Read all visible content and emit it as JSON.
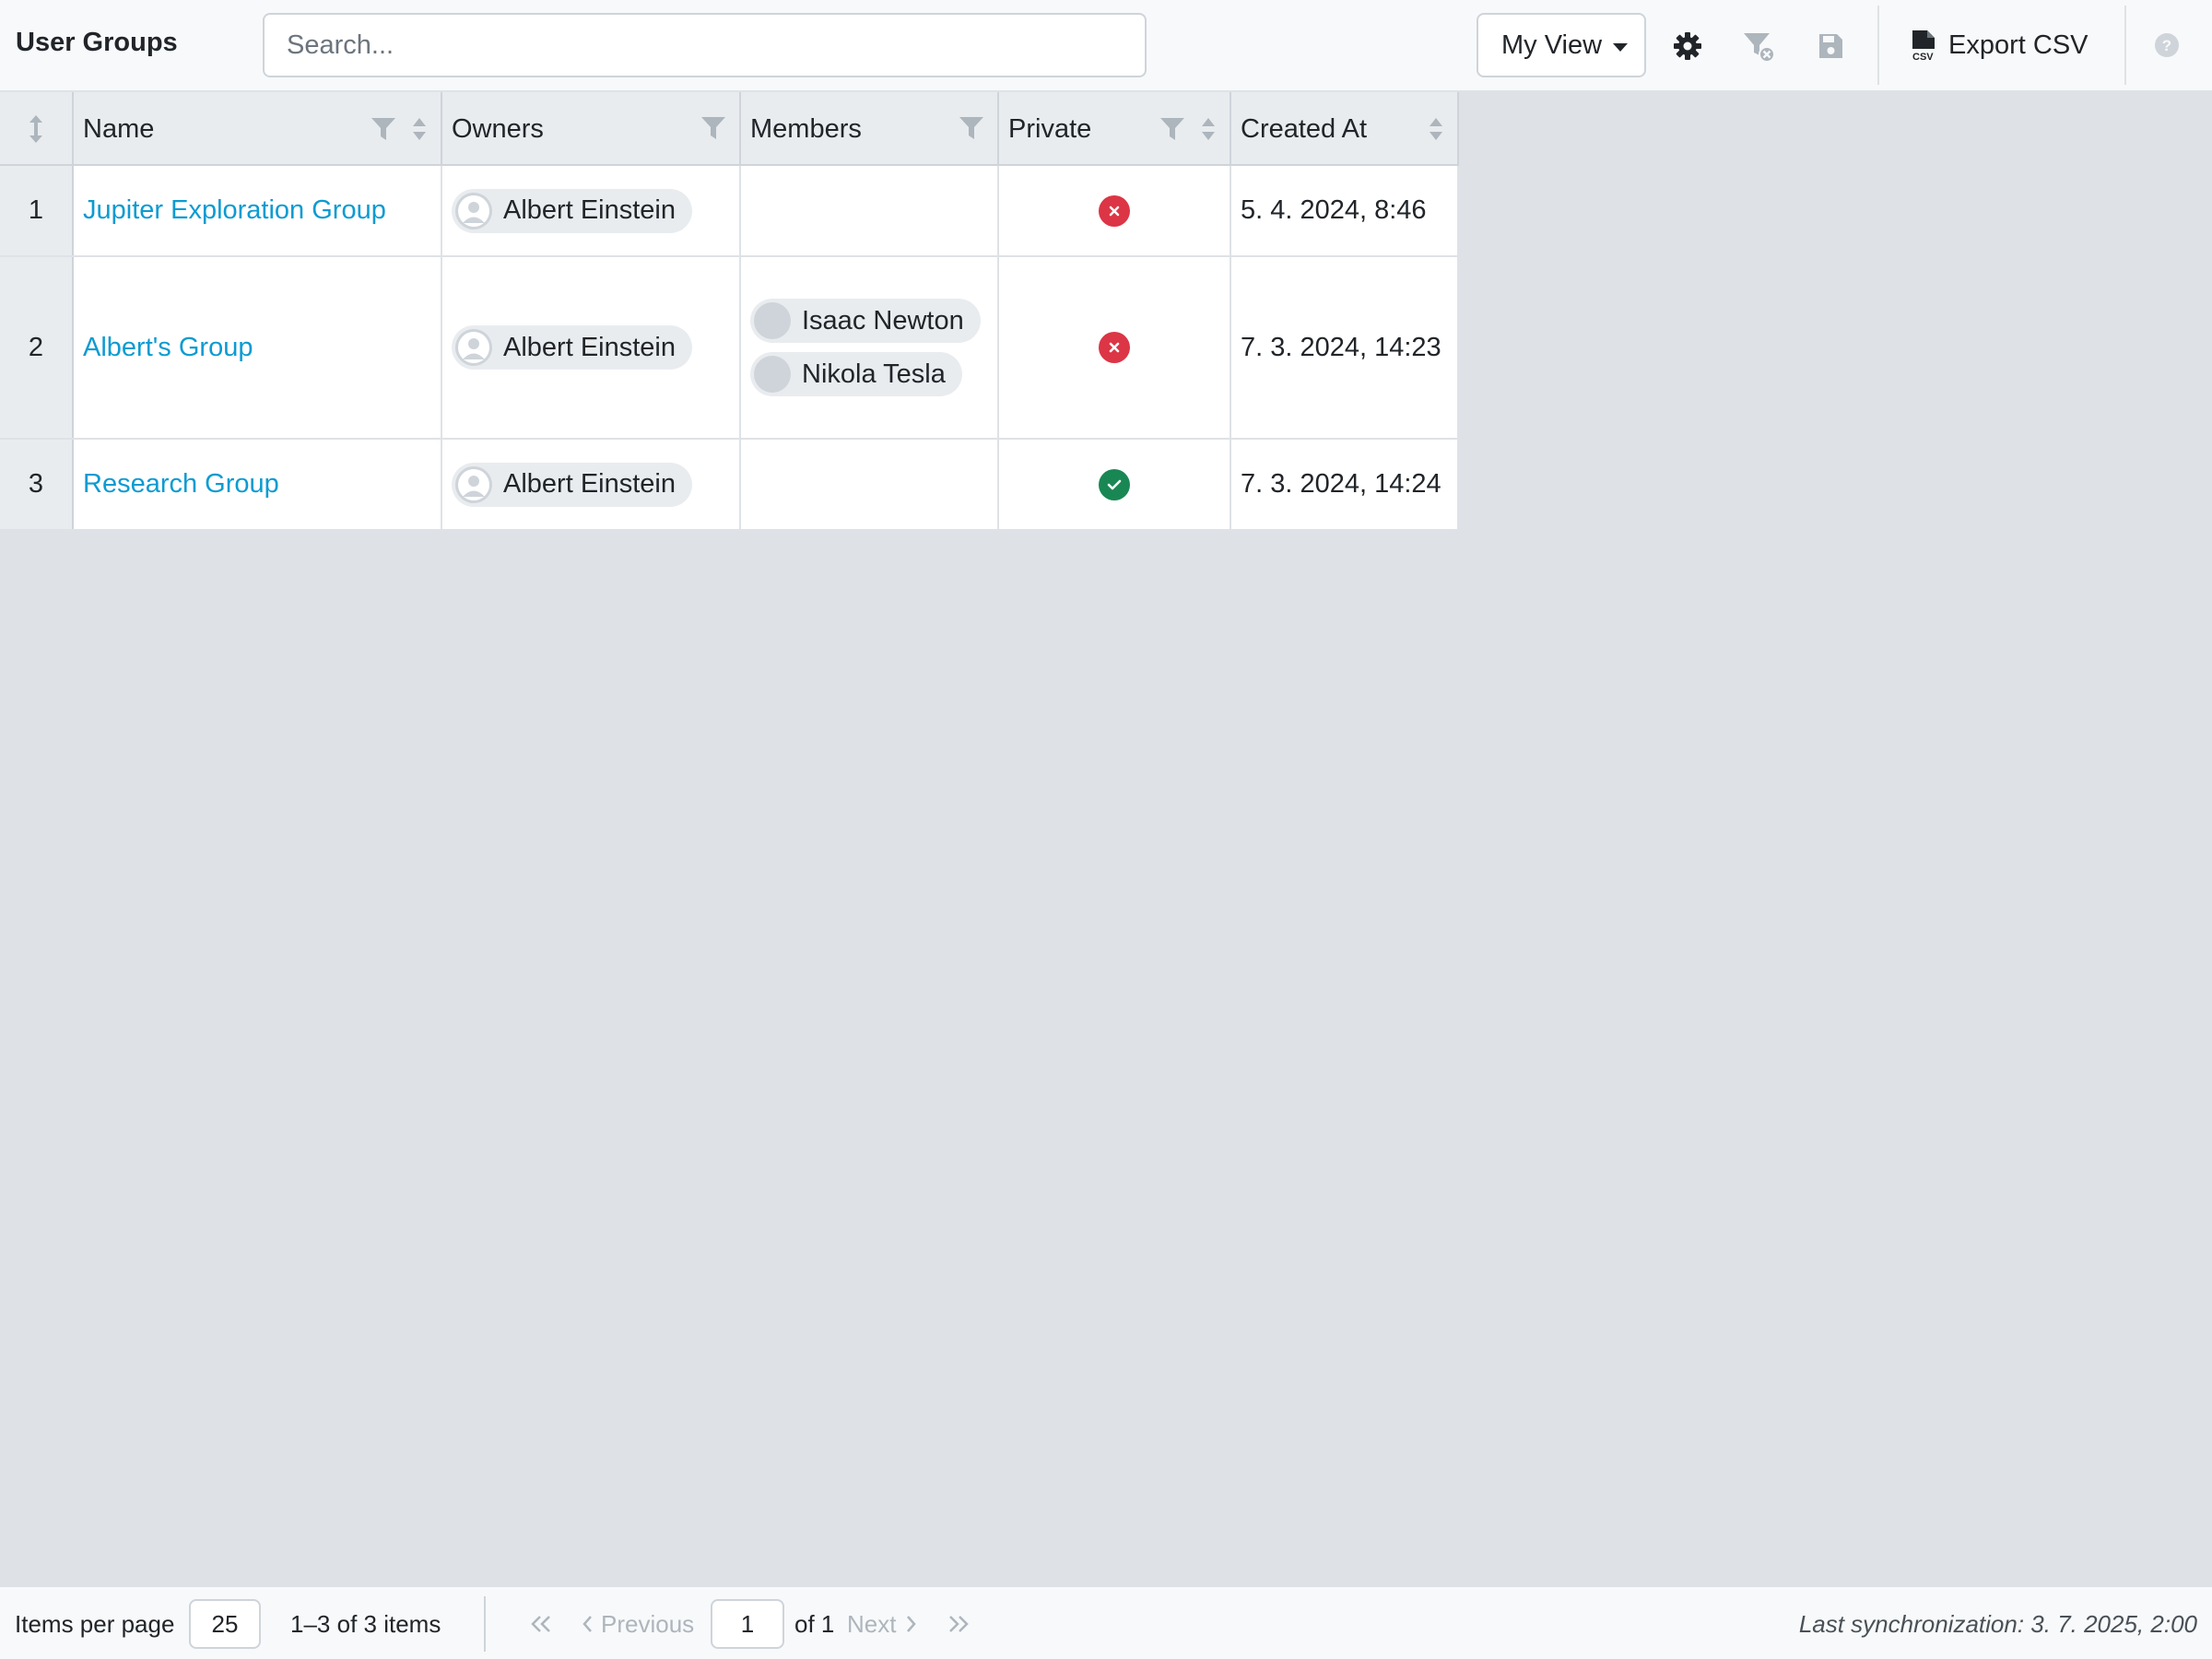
{
  "header": {
    "title": "User Groups",
    "search_placeholder": "Search...",
    "view_selected": "My View",
    "export_label": "Export CSV",
    "icons": [
      "gear-icon",
      "clear-filter-icon",
      "save-icon",
      "help-icon"
    ]
  },
  "table": {
    "columns": [
      {
        "label": "Name"
      },
      {
        "label": "Owners"
      },
      {
        "label": "Members"
      },
      {
        "label": "Private"
      },
      {
        "label": "Created At"
      }
    ],
    "rows": [
      {
        "num": "1",
        "name": "Jupiter Exploration Group",
        "owners": [
          "Albert Einstein"
        ],
        "members": [],
        "private": false,
        "created_at": "5. 4. 2024, 8:46"
      },
      {
        "num": "2",
        "name": "Albert's Group",
        "owners": [
          "Albert Einstein"
        ],
        "members": [
          "Isaac Newton",
          "Nikola Tesla"
        ],
        "private": false,
        "created_at": "7. 3. 2024, 14:23"
      },
      {
        "num": "3",
        "name": "Research Group",
        "owners": [
          "Albert Einstein"
        ],
        "members": [],
        "private": true,
        "created_at": "7. 3. 2024, 14:24"
      }
    ]
  },
  "footer": {
    "items_per_page_label": "Items per page",
    "items_per_page_value": "25",
    "range_text": "1–3 of 3 items",
    "previous_label": "Previous",
    "page_value": "1",
    "of_pages": "of 1",
    "next_label": "Next",
    "last_sync": "Last synchronization: 3. 7. 2025, 2:00"
  },
  "colors": {
    "link": "#0d9bd1",
    "false_status": "#dc3545",
    "true_status": "#198754"
  }
}
